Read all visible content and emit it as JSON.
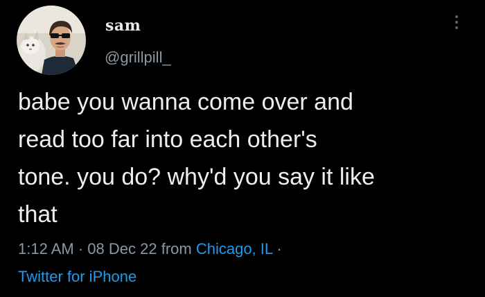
{
  "user": {
    "display_name": "sam",
    "handle": "@grillpill_"
  },
  "tweet": {
    "lines": [
      "babe you wanna come over and",
      "read too far into each other's",
      "tone. you do? why'd you say it like",
      "that"
    ],
    "time": "1:12 AM",
    "separator": "·",
    "date": "08 Dec 22",
    "from_text": "from",
    "location": "Chicago, IL",
    "source": "Twitter for iPhone"
  },
  "colors": {
    "background": "#000000",
    "text": "#e7e9ea",
    "secondary": "#8b98a5",
    "link": "#1d9bf0"
  },
  "icons": {
    "menu": "more-vertical-icon"
  }
}
